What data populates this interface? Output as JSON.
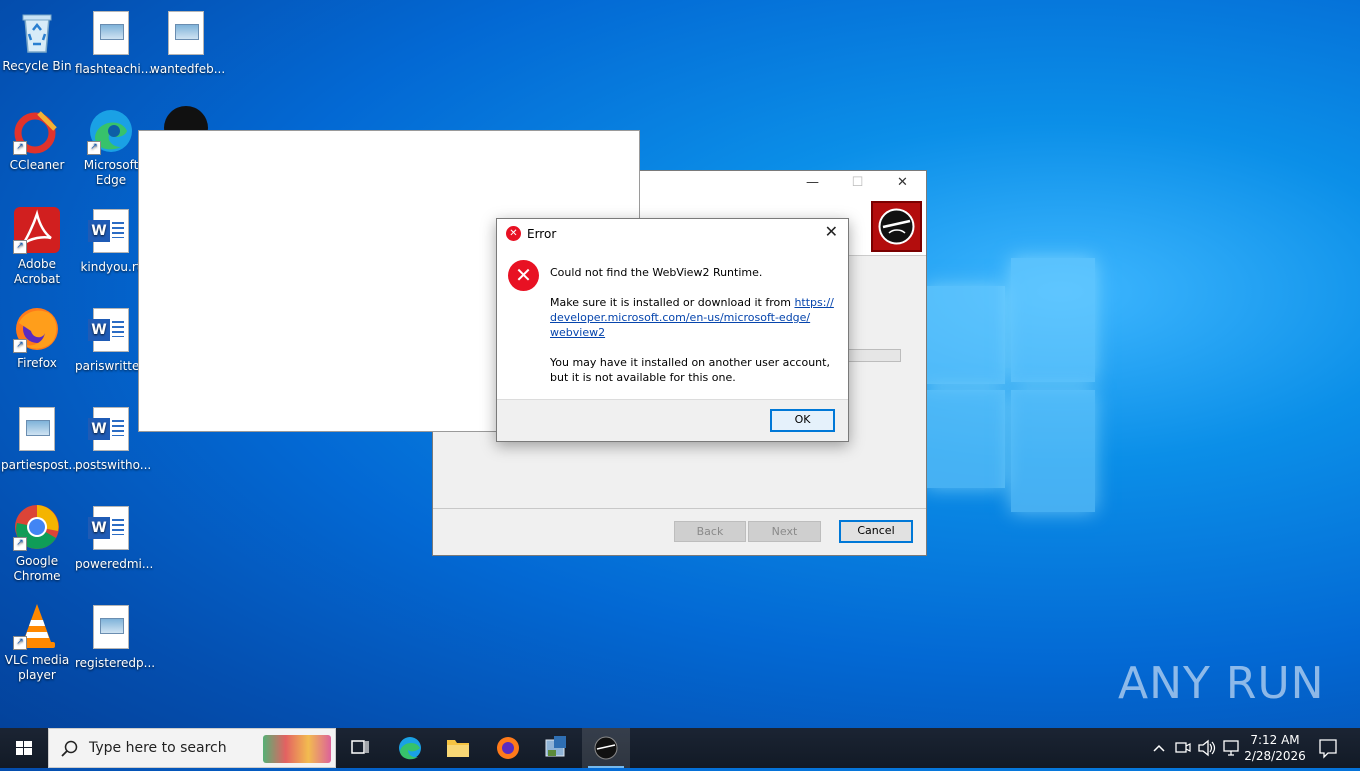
{
  "desktop": {
    "icons": [
      {
        "label": "Recycle Bin"
      },
      {
        "label": "flashteachi..."
      },
      {
        "label": "wantedfeb..."
      },
      {
        "label": "CCleaner"
      },
      {
        "label": "Microsoft Edge"
      },
      {
        "label": "Adobe Acrobat"
      },
      {
        "label": "kindyou.rt"
      },
      {
        "label": "Firefox"
      },
      {
        "label": "pariswritte..."
      },
      {
        "label": "partiespost..."
      },
      {
        "label": "postswitho..."
      },
      {
        "label": "Google Chrome"
      },
      {
        "label": "poweredmi..."
      },
      {
        "label": "VLC media player"
      },
      {
        "label": "registeredp..."
      }
    ]
  },
  "wizard": {
    "back_label": "Back",
    "next_label": "Next",
    "cancel_label": "Cancel"
  },
  "error_dialog": {
    "title": "Error",
    "heading": "Could not find the WebView2 Runtime.",
    "install_text": "Make sure it is installed or download it from ",
    "link": "https://developer.microsoft.com/en-us/microsoft-edge/webview2",
    "link_line1": "https://",
    "link_line2": "developer.microsoft.com/en-us/microsoft-edge/",
    "link_line3": "webview2",
    "other_account_text": "You may have it installed on another user account, but it is not available for this one.",
    "ok_label": "OK"
  },
  "taskbar": {
    "search_placeholder": "Type here to search",
    "time": "7:12 AM",
    "date": "2/28/2026"
  },
  "watermark": "ANY RUN",
  "colors": {
    "accent": "#0078d7",
    "error_red": "#e81123",
    "taskbar_bg": "#121a26"
  }
}
